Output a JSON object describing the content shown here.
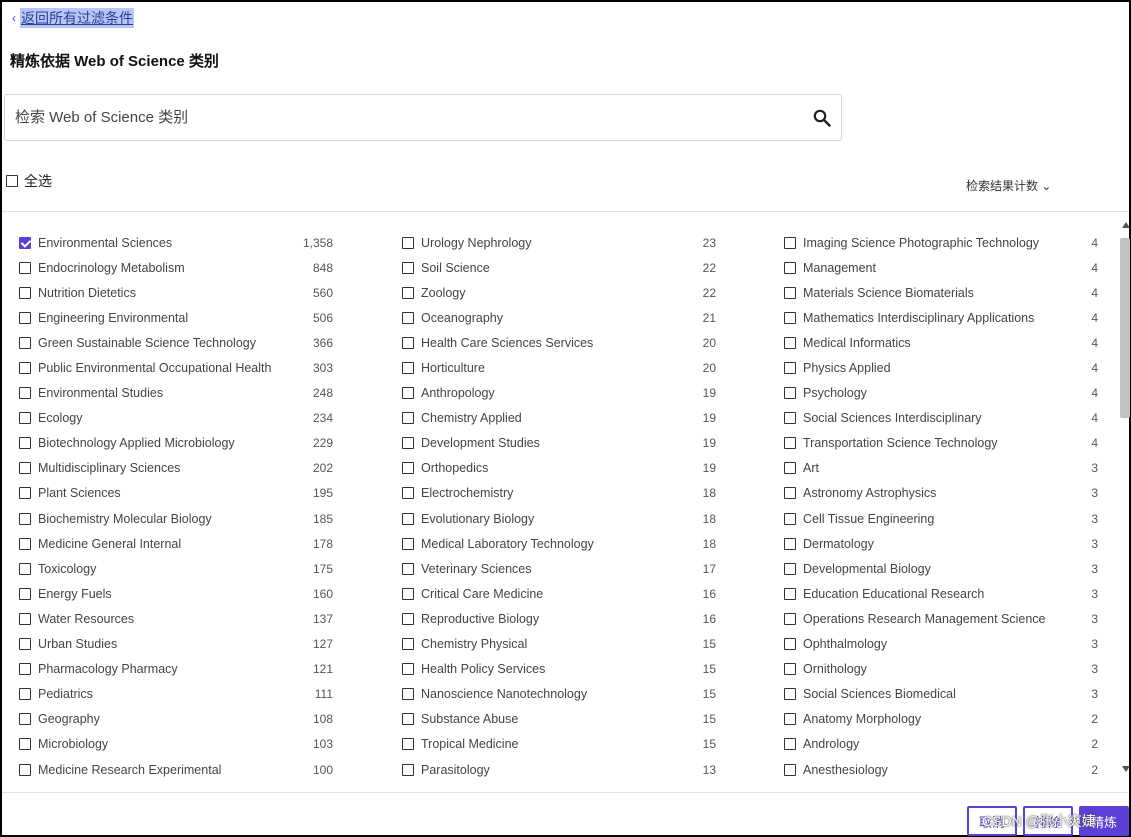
{
  "back_link": {
    "label": "返回所有过滤条件"
  },
  "heading": "精炼依据 Web of Science 类别",
  "search": {
    "placeholder": "检索 Web of Science 类别"
  },
  "select_all": {
    "label": "全选"
  },
  "sort": {
    "label": "检索结果计数"
  },
  "columns": [
    [
      {
        "label": "Environmental Sciences",
        "count": "1,358",
        "checked": true
      },
      {
        "label": "Endocrinology Metabolism",
        "count": "848"
      },
      {
        "label": "Nutrition Dietetics",
        "count": "560"
      },
      {
        "label": "Engineering Environmental",
        "count": "506"
      },
      {
        "label": "Green Sustainable Science Technology",
        "count": "366"
      },
      {
        "label": "Public Environmental Occupational Health",
        "count": "303"
      },
      {
        "label": "Environmental Studies",
        "count": "248"
      },
      {
        "label": "Ecology",
        "count": "234"
      },
      {
        "label": "Biotechnology Applied Microbiology",
        "count": "229"
      },
      {
        "label": "Multidisciplinary Sciences",
        "count": "202"
      },
      {
        "label": "Plant Sciences",
        "count": "195"
      },
      {
        "label": "Biochemistry Molecular Biology",
        "count": "185"
      },
      {
        "label": "Medicine General Internal",
        "count": "178"
      },
      {
        "label": "Toxicology",
        "count": "175"
      },
      {
        "label": "Energy Fuels",
        "count": "160"
      },
      {
        "label": "Water Resources",
        "count": "137"
      },
      {
        "label": "Urban Studies",
        "count": "127"
      },
      {
        "label": "Pharmacology Pharmacy",
        "count": "121"
      },
      {
        "label": "Pediatrics",
        "count": "111"
      },
      {
        "label": "Geography",
        "count": "108"
      },
      {
        "label": "Microbiology",
        "count": "103"
      },
      {
        "label": "Medicine Research Experimental",
        "count": "100"
      }
    ],
    [
      {
        "label": "Urology Nephrology",
        "count": "23"
      },
      {
        "label": "Soil Science",
        "count": "22"
      },
      {
        "label": "Zoology",
        "count": "22"
      },
      {
        "label": "Oceanography",
        "count": "21"
      },
      {
        "label": "Health Care Sciences Services",
        "count": "20"
      },
      {
        "label": "Horticulture",
        "count": "20"
      },
      {
        "label": "Anthropology",
        "count": "19"
      },
      {
        "label": "Chemistry Applied",
        "count": "19"
      },
      {
        "label": "Development Studies",
        "count": "19"
      },
      {
        "label": "Orthopedics",
        "count": "19"
      },
      {
        "label": "Electrochemistry",
        "count": "18"
      },
      {
        "label": "Evolutionary Biology",
        "count": "18"
      },
      {
        "label": "Medical Laboratory Technology",
        "count": "18"
      },
      {
        "label": "Veterinary Sciences",
        "count": "17"
      },
      {
        "label": "Critical Care Medicine",
        "count": "16"
      },
      {
        "label": "Reproductive Biology",
        "count": "16"
      },
      {
        "label": "Chemistry Physical",
        "count": "15"
      },
      {
        "label": "Health Policy Services",
        "count": "15"
      },
      {
        "label": "Nanoscience Nanotechnology",
        "count": "15"
      },
      {
        "label": "Substance Abuse",
        "count": "15"
      },
      {
        "label": "Tropical Medicine",
        "count": "15"
      },
      {
        "label": "Parasitology",
        "count": "13"
      }
    ],
    [
      {
        "label": "Imaging Science Photographic Technology",
        "count": "4"
      },
      {
        "label": "Management",
        "count": "4"
      },
      {
        "label": "Materials Science Biomaterials",
        "count": "4"
      },
      {
        "label": "Mathematics Interdisciplinary Applications",
        "count": "4"
      },
      {
        "label": "Medical Informatics",
        "count": "4"
      },
      {
        "label": "Physics Applied",
        "count": "4"
      },
      {
        "label": "Psychology",
        "count": "4"
      },
      {
        "label": "Social Sciences Interdisciplinary",
        "count": "4"
      },
      {
        "label": "Transportation Science Technology",
        "count": "4"
      },
      {
        "label": "Art",
        "count": "3"
      },
      {
        "label": "Astronomy Astrophysics",
        "count": "3"
      },
      {
        "label": "Cell Tissue Engineering",
        "count": "3"
      },
      {
        "label": "Dermatology",
        "count": "3"
      },
      {
        "label": "Developmental Biology",
        "count": "3"
      },
      {
        "label": "Education Educational Research",
        "count": "3"
      },
      {
        "label": "Operations Research Management Science",
        "count": "3"
      },
      {
        "label": "Ophthalmology",
        "count": "3"
      },
      {
        "label": "Ornithology",
        "count": "3"
      },
      {
        "label": "Social Sciences Biomedical",
        "count": "3"
      },
      {
        "label": "Anatomy Morphology",
        "count": "2"
      },
      {
        "label": "Andrology",
        "count": "2"
      },
      {
        "label": "Anesthesiology",
        "count": "2"
      }
    ]
  ],
  "buttons": {
    "cancel": "取消",
    "exclude": "排除",
    "refine": "精炼"
  },
  "watermark": "CSDN @张小爽婕",
  "colors": {
    "accent": "#5b3fd6",
    "link_highlight": "#b7c6f5"
  }
}
